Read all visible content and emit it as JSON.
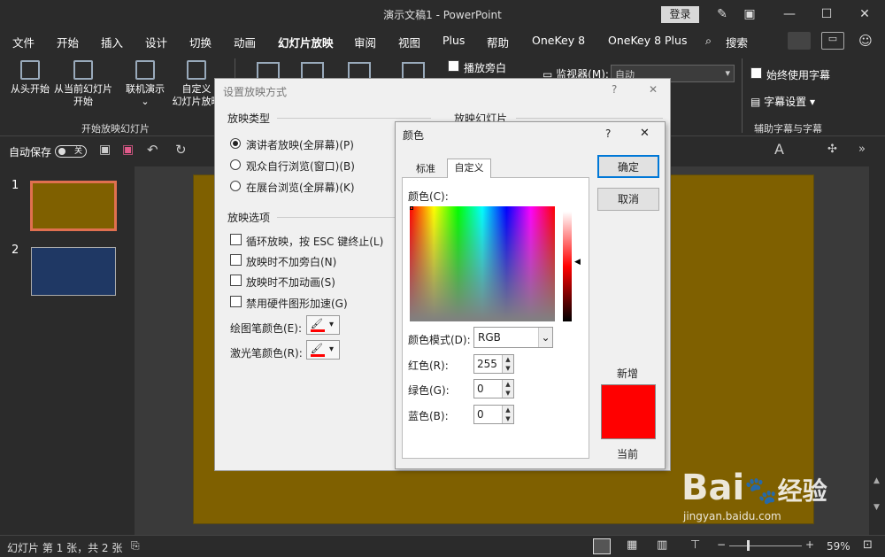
{
  "window": {
    "title": "演示文稿1  -  PowerPoint",
    "login": "登录"
  },
  "tabs": [
    "文件",
    "开始",
    "插入",
    "设计",
    "切换",
    "动画",
    "幻灯片放映",
    "审阅",
    "视图",
    "Plus",
    "帮助",
    "OneKey 8",
    "OneKey 8 Plus"
  ],
  "search_label": "搜索",
  "ribbon": {
    "from_start": "从头开始",
    "from_current_1": "从当前幻灯片",
    "from_current_2": "开始",
    "online_1": "联机演示",
    "custom_1": "自定义",
    "custom_2": "幻灯片放映",
    "group_start": "开始放映幻灯片",
    "play_narration": "播放旁白",
    "monitor_label": "监视器(M):",
    "monitor_value": "自动",
    "always_subtitles": "始终使用字幕",
    "subtitle_settings": "字幕设置",
    "group_captions": "辅助字幕与字幕"
  },
  "qat": {
    "autosave": "自动保存",
    "toggle": "关"
  },
  "slides": [
    {
      "num": "1",
      "color": "#7f6000"
    },
    {
      "num": "2",
      "color": "#1f3864"
    }
  ],
  "status": {
    "slide_info": "幻灯片 第 1 张，共 2 张",
    "zoom": "59%"
  },
  "setup": {
    "title": "设置放映方式",
    "help": "?",
    "close": "✕",
    "type_title": "放映类型",
    "types": [
      "演讲者放映(全屏幕)(P)",
      "观众自行浏览(窗口)(B)",
      "在展台浏览(全屏幕)(K)"
    ],
    "options_title": "放映选项",
    "options": [
      "循环放映，按 ESC 键终止(L)",
      "放映时不加旁白(N)",
      "放映时不加动画(S)",
      "禁用硬件图形加速(G)"
    ],
    "pen_color": "绘图笔颜色(E):",
    "laser_color": "激光笔颜色(R):",
    "slides_title": "放映幻灯片"
  },
  "color": {
    "title": "颜色",
    "help": "?",
    "close": "✕",
    "tab_standard": "标准",
    "tab_custom": "自定义",
    "colors_label": "颜色(C):",
    "model_label": "颜色模式(D):",
    "model_value": "RGB",
    "red_label": "红色(R):",
    "red": "255",
    "green_label": "绿色(G):",
    "green": "0",
    "blue_label": "蓝色(B):",
    "blue": "0",
    "ok": "确定",
    "cancel": "取消",
    "new_label": "新增",
    "current_label": "当前",
    "new_color": "#ff0000"
  },
  "watermark": {
    "brand": "Bai",
    "brand2": "经验",
    "url": "jingyan.baidu.com"
  }
}
